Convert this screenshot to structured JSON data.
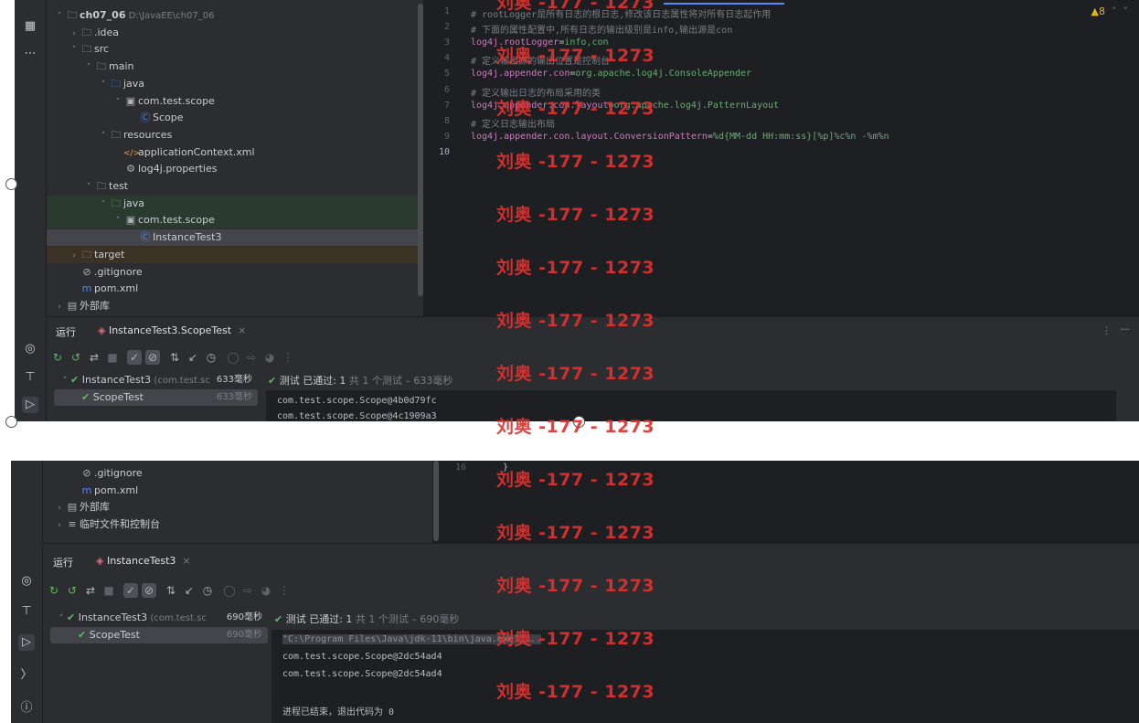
{
  "top": {
    "project_tree": [
      {
        "label": "ch07_06",
        "suffix": "D:\\JavaEE\\ch07_06",
        "indent": 0,
        "chevron": "v",
        "icon": "module-folder-icon"
      },
      {
        "label": ".idea",
        "indent": 1,
        "chevron": ">",
        "icon": "folder-icon"
      },
      {
        "label": "src",
        "indent": 1,
        "chevron": "v",
        "icon": "folder-icon"
      },
      {
        "label": "main",
        "indent": 2,
        "chevron": "v",
        "icon": "folder-icon"
      },
      {
        "label": "java",
        "indent": 3,
        "chevron": "v",
        "icon": "source-folder-icon"
      },
      {
        "label": "com.test.scope",
        "indent": 4,
        "chevron": "v",
        "icon": "package-icon"
      },
      {
        "label": "Scope",
        "indent": 5,
        "chevron": "",
        "icon": "class-icon"
      },
      {
        "label": "resources",
        "indent": 3,
        "chevron": "v",
        "icon": "resources-folder-icon"
      },
      {
        "label": "applicationContext.xml",
        "indent": 4,
        "chevron": "",
        "icon": "xml-file-icon"
      },
      {
        "label": "log4j.properties",
        "indent": 4,
        "chevron": "",
        "icon": "properties-file-icon"
      },
      {
        "label": "test",
        "indent": 2,
        "chevron": "v",
        "icon": "folder-icon"
      },
      {
        "label": "java",
        "indent": 3,
        "chevron": "v",
        "icon": "test-source-folder-icon"
      },
      {
        "label": "com.test.scope",
        "indent": 4,
        "chevron": "v",
        "icon": "package-icon"
      },
      {
        "label": "InstanceTest3",
        "indent": 5,
        "chevron": "",
        "icon": "class-icon"
      },
      {
        "label": "target",
        "indent": 1,
        "chevron": ">",
        "icon": "excluded-folder-icon"
      },
      {
        "label": ".gitignore",
        "indent": 1,
        "chevron": "",
        "icon": "gitignore-icon"
      },
      {
        "label": "pom.xml",
        "indent": 1,
        "chevron": "",
        "icon": "maven-icon"
      },
      {
        "label": "外部库",
        "indent": 0,
        "chevron": ">",
        "icon": "library-icon"
      }
    ],
    "editor": {
      "lines": [
        {
          "n": "1",
          "text": "# rootLogger是所有日志的根日志,修改该日志属性将对所有日志起作用",
          "kind": "comment"
        },
        {
          "n": "2",
          "text": "# 下面的属性配置中,所有日志的输出级别是info,输出源是con",
          "kind": "comment"
        },
        {
          "n": "3",
          "text": "log4j.rootLogger=info,con",
          "kind": "kv"
        },
        {
          "n": "4",
          "text": "# 定义输出源的输出位置是控制台",
          "kind": "comment"
        },
        {
          "n": "5",
          "text": "log4j.appender.con=org.apache.log4j.ConsoleAppender",
          "kind": "kv"
        },
        {
          "n": "6",
          "text": "# 定义输出日志的布局采用的类",
          "kind": "comment"
        },
        {
          "n": "7",
          "text": "log4j.appender.con.layout=org.apache.log4j.PatternLayout",
          "kind": "kv"
        },
        {
          "n": "8",
          "text": "# 定义日志输出布局",
          "kind": "comment"
        },
        {
          "n": "9",
          "text": "log4j.appender.con.layout.ConversionPattern=%d{MM-dd HH:mm:ss}[%p]%c%n -%m%n",
          "kind": "kv"
        },
        {
          "n": "10",
          "text": "",
          "kind": "plain"
        }
      ],
      "warnings": "▲8"
    },
    "run_label": "运行",
    "run_tab": "InstanceTest3.ScopeTest",
    "tests": [
      {
        "label": "InstanceTest3",
        "pkg": "(com.test.sc",
        "time": "633毫秒",
        "root": true
      },
      {
        "label": "ScopeTest",
        "pkg": "",
        "time": "633毫秒",
        "root": false
      }
    ],
    "status": "测试 已通过: 1",
    "status_detail": "共 1 个测试 – 633毫秒",
    "console": [
      "com.test.scope.Scope@4b0d79fc",
      "com.test.scope.Scope@4c1909a3"
    ]
  },
  "bottom": {
    "tree": [
      {
        "label": ".gitignore",
        "indent": 1,
        "chevron": "",
        "icon": "gitignore-icon"
      },
      {
        "label": "pom.xml",
        "indent": 1,
        "chevron": "",
        "icon": "maven-icon"
      },
      {
        "label": "外部库",
        "indent": 0,
        "chevron": ">",
        "icon": "library-icon"
      },
      {
        "label": "临时文件和控制台",
        "indent": 0,
        "chevron": ">",
        "icon": "scratches-icon"
      }
    ],
    "editor_line_no": "16",
    "editor_code": "}",
    "run_label": "运行",
    "run_tab": "InstanceTest3",
    "tests": [
      {
        "label": "InstanceTest3",
        "pkg": "(com.test.sc",
        "time": "690毫秒",
        "root": true
      },
      {
        "label": "ScopeTest",
        "pkg": "",
        "time": "690毫秒",
        "root": false
      }
    ],
    "status": "测试 已通过: 1",
    "status_detail": "共 1 个测试 – 690毫秒",
    "console": [
      "\"C:\\Program Files\\Java\\jdk-11\\bin\\java.exe\" ...",
      "com.test.scope.Scope@2dc54ad4",
      "com.test.scope.Scope@2dc54ad4",
      "",
      "进程已结束，退出代码为 0"
    ]
  },
  "watermark": "刘奥 -177 - 1273",
  "colors": {
    "bg": "#1e1f22",
    "panel": "#2b2d30",
    "green": "#5fb865",
    "watermark": "#e0312f",
    "accent": "#548af7"
  }
}
